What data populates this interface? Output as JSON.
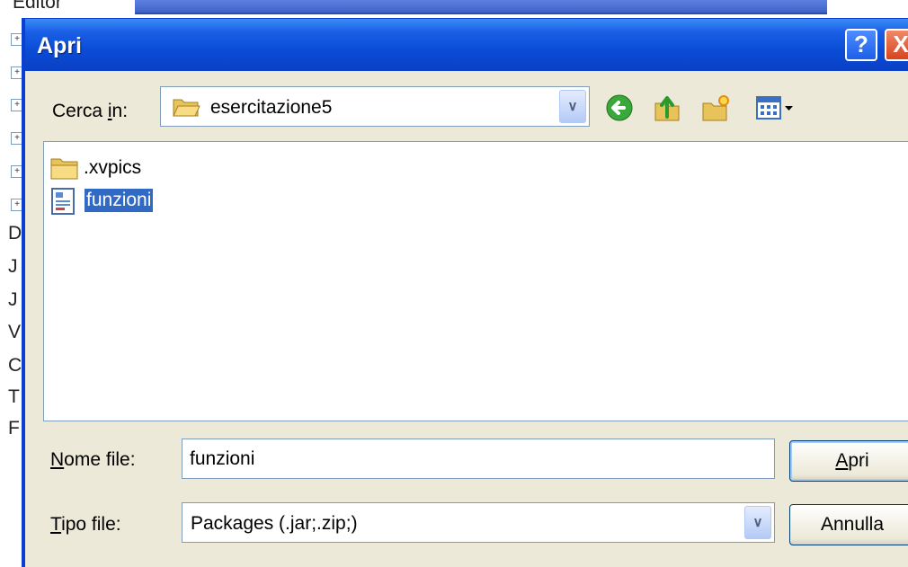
{
  "background_app": {
    "partial_word": "Editor",
    "tree_expanders": [
      "+",
      "+",
      "+",
      "+",
      "+",
      "+"
    ],
    "letters": [
      "D",
      "J",
      "J",
      "V",
      "C",
      "T",
      "F"
    ]
  },
  "dialog": {
    "title": "Apri",
    "help_glyph": "?",
    "close_glyph": "X",
    "look_in": {
      "label_pre": "Cerca ",
      "label_accel": "i",
      "label_post": "n:",
      "value": "esercitazione5",
      "folder_icon": "folder-open-icon"
    },
    "toolbar": {
      "back_icon": "back-arrow-icon",
      "up_icon": "up-folder-icon",
      "new_folder_icon": "new-folder-icon",
      "views_icon": "view-menu-icon"
    },
    "files": [
      {
        "name": ".xvpics",
        "icon": "folder-icon",
        "selected": false
      },
      {
        "name": "funzioni",
        "icon": "java-package-icon",
        "selected": true
      }
    ],
    "file_name": {
      "label_accel": "N",
      "label_rest": "ome file:",
      "value": "funzioni"
    },
    "file_type": {
      "label_accel": "T",
      "label_rest": "ipo file:",
      "value": "Packages (.jar;.zip;)"
    },
    "open_button": {
      "accel": "A",
      "rest": "pri"
    },
    "cancel_button": "Annulla"
  }
}
